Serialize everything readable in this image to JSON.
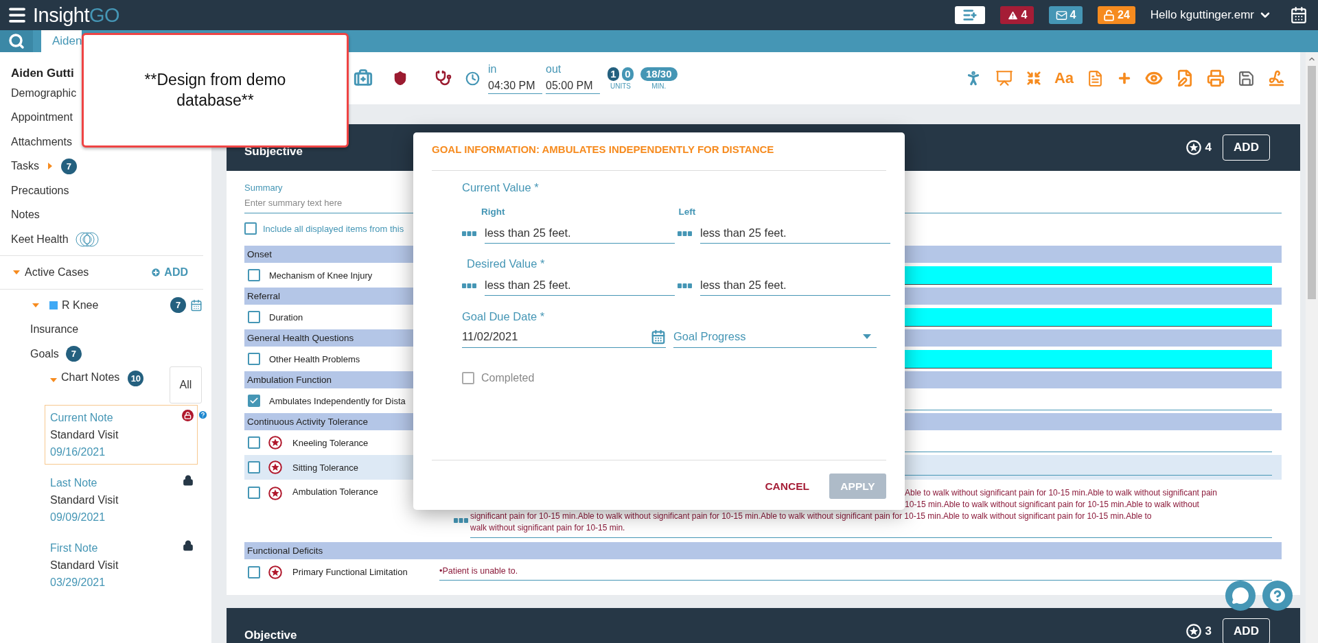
{
  "top_bar": {
    "logo_primary": "Insight",
    "logo_accent": "GO",
    "badges": [
      {
        "kind": "add-list",
        "color": "#ffffff"
      },
      {
        "kind": "alert",
        "count": "4",
        "color": "#a51d36"
      },
      {
        "kind": "mail",
        "count": "4",
        "color": "#4596b5"
      },
      {
        "kind": "unlock",
        "count": "24",
        "color": "#f68b1f"
      }
    ],
    "user_menu": "Hello kguttinger.emr"
  },
  "patient_tab": {
    "label": "Aiden",
    "selected": true
  },
  "overlay_note": "**Design from demo database**",
  "sidebar": {
    "patient_name": "Aiden Gutti",
    "links": [
      {
        "label": "Demographic",
        "kind": "plain"
      },
      {
        "label": "Appointment",
        "kind": "plain"
      },
      {
        "label": "Attachments",
        "kind": "plain"
      },
      {
        "label": "Tasks",
        "kind": "collapsed",
        "badge": "7"
      },
      {
        "label": "Precautions",
        "kind": "plain"
      },
      {
        "label": "Notes",
        "kind": "plain"
      },
      {
        "label": "Keet Health",
        "kind": "keet"
      }
    ],
    "active_cases": {
      "label": "Active Cases",
      "expanded": true,
      "add_label": "ADD"
    },
    "case": {
      "label": "R Knee",
      "expanded": true,
      "badge": "7",
      "links": [
        {
          "label": "Insurance"
        },
        {
          "label": "Goals",
          "badge": "7"
        }
      ],
      "chart_notes": {
        "label": "Chart Notes",
        "expanded": true,
        "badge": "10",
        "filter": "All",
        "notes": [
          {
            "title": "Current Note",
            "type": "Standard Visit",
            "date": "09/16/2021",
            "selected": true,
            "locked": false
          },
          {
            "title": "Last Note",
            "type": "Standard Visit",
            "date": "09/09/2021",
            "selected": false,
            "locked": true
          },
          {
            "title": "First Note",
            "type": "Standard Visit",
            "date": "03/29/2021",
            "selected": false,
            "locked": true
          }
        ]
      }
    }
  },
  "header": {
    "time_in": {
      "label": "in",
      "value": "04:30 PM"
    },
    "time_out": {
      "label": "out",
      "value": "05:00 PM"
    },
    "units": {
      "values": [
        "1",
        "0"
      ],
      "label": "UNITS"
    },
    "minutes": {
      "value": "18/30",
      "label": "MIN."
    },
    "font_tool": "Aa"
  },
  "sections": [
    {
      "title": "Subjective",
      "star_count": "4",
      "add_label": "ADD",
      "summary": {
        "label": "Summary",
        "placeholder": "Enter summary text here"
      },
      "include": {
        "label": "Include all displayed items from this",
        "checked": false
      },
      "groups": [
        {
          "title": "Onset",
          "items": [
            {
              "label": "Mechanism of Knee Injury",
              "checked": false,
              "starred": false,
              "selected": false,
              "kind": "highlighted"
            }
          ]
        },
        {
          "title": "Referral",
          "items": [
            {
              "label": "Duration",
              "checked": false,
              "starred": false,
              "selected": false,
              "kind": "highlighted"
            }
          ]
        },
        {
          "title": "General Health Questions",
          "items": [
            {
              "label": "Other Health Problems",
              "checked": false,
              "starred": false,
              "selected": false,
              "kind": "highlighted"
            }
          ]
        },
        {
          "title": "Ambulation Function",
          "items": [
            {
              "label": "Ambulates Independently for Dista",
              "checked": true,
              "starred": false,
              "selected": false,
              "kind": "underlined"
            }
          ]
        },
        {
          "title": "Continuous Activity Tolerance",
          "items": [
            {
              "label": "Kneeling Tolerance",
              "checked": false,
              "starred": true,
              "selected": false,
              "kind": "underlined"
            },
            {
              "label": "Sitting Tolerance",
              "checked": false,
              "starred": true,
              "selected": true,
              "kind": "underlined"
            },
            {
              "label": "Ambulation Tolerance",
              "checked": false,
              "starred": true,
              "selected": false,
              "kind": "long_text",
              "value_fragments": [
                "Able to walk without significant pain for 10-15 min.Able to walk without significant pain",
                "10-15 min.Able to walk without significant pain for 10-15 min.Able to walk without"
              ],
              "value_lines": [
                "significant pain for 10-15 min.Able to walk without significant pain for 10-15 min.Able to walk without significant pain for 10-15 min.Able to walk without significant pain for 10-15 min.Able to",
                "walk without significant pain for 10-15 min."
              ]
            }
          ]
        },
        {
          "title": "Functional Deficits",
          "items": [
            {
              "label": "Primary Functional Limitation",
              "checked": false,
              "starred": true,
              "selected": false,
              "kind": "text",
              "value_lines": [
                "•Patient is unable to."
              ]
            }
          ]
        }
      ]
    },
    {
      "title": "Objective",
      "star_count": "3",
      "add_label": "ADD"
    }
  ],
  "modal": {
    "title": "GOAL INFORMATION: AMBULATES INDEPENDENTLY FOR DISTANCE",
    "current": {
      "label": "Current Value *",
      "right_label": "Right",
      "left_label": "Left",
      "right": "less than 25 feet.",
      "left": "less than 25 feet."
    },
    "desired": {
      "label": "Desired Value *",
      "right": "less than 25 feet.",
      "left": "less than 25 feet."
    },
    "due_date": {
      "label": "Goal Due Date *",
      "value": "11/02/2021"
    },
    "progress": {
      "label": "Goal Progress"
    },
    "completed": {
      "label": "Completed",
      "checked": false
    },
    "cancel": "CANCEL",
    "apply": {
      "label": "APPLY",
      "disabled": true
    }
  }
}
